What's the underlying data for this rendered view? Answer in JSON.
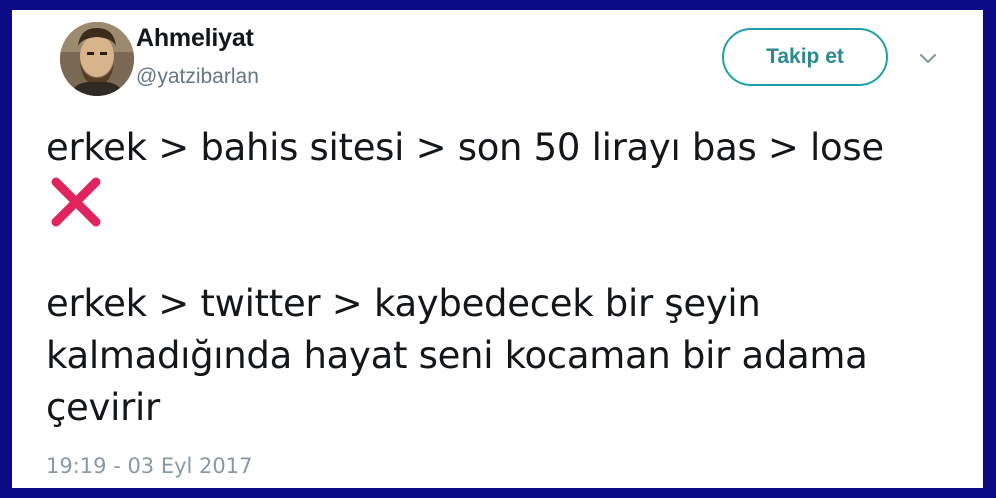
{
  "author": {
    "display_name": "Ahmeliyat",
    "handle": "@yatzibarlan"
  },
  "actions": {
    "follow_label": "Takip et"
  },
  "tweet": {
    "line1": "erkek > bahis sitesi > son 50 lirayı bas > lose",
    "line2": "erkek > twitter > kaybedecek bir şeyin",
    "line3": "kalmadığında hayat seni kocaman bir adama",
    "line4": "çevirir",
    "emoji": "cross-mark-icon"
  },
  "meta": {
    "timestamp": "19:19 - 03 Eyl 2017"
  },
  "colors": {
    "frame": "#0b0b85",
    "accent": "#1da1a6",
    "cross": "#e0245e"
  }
}
